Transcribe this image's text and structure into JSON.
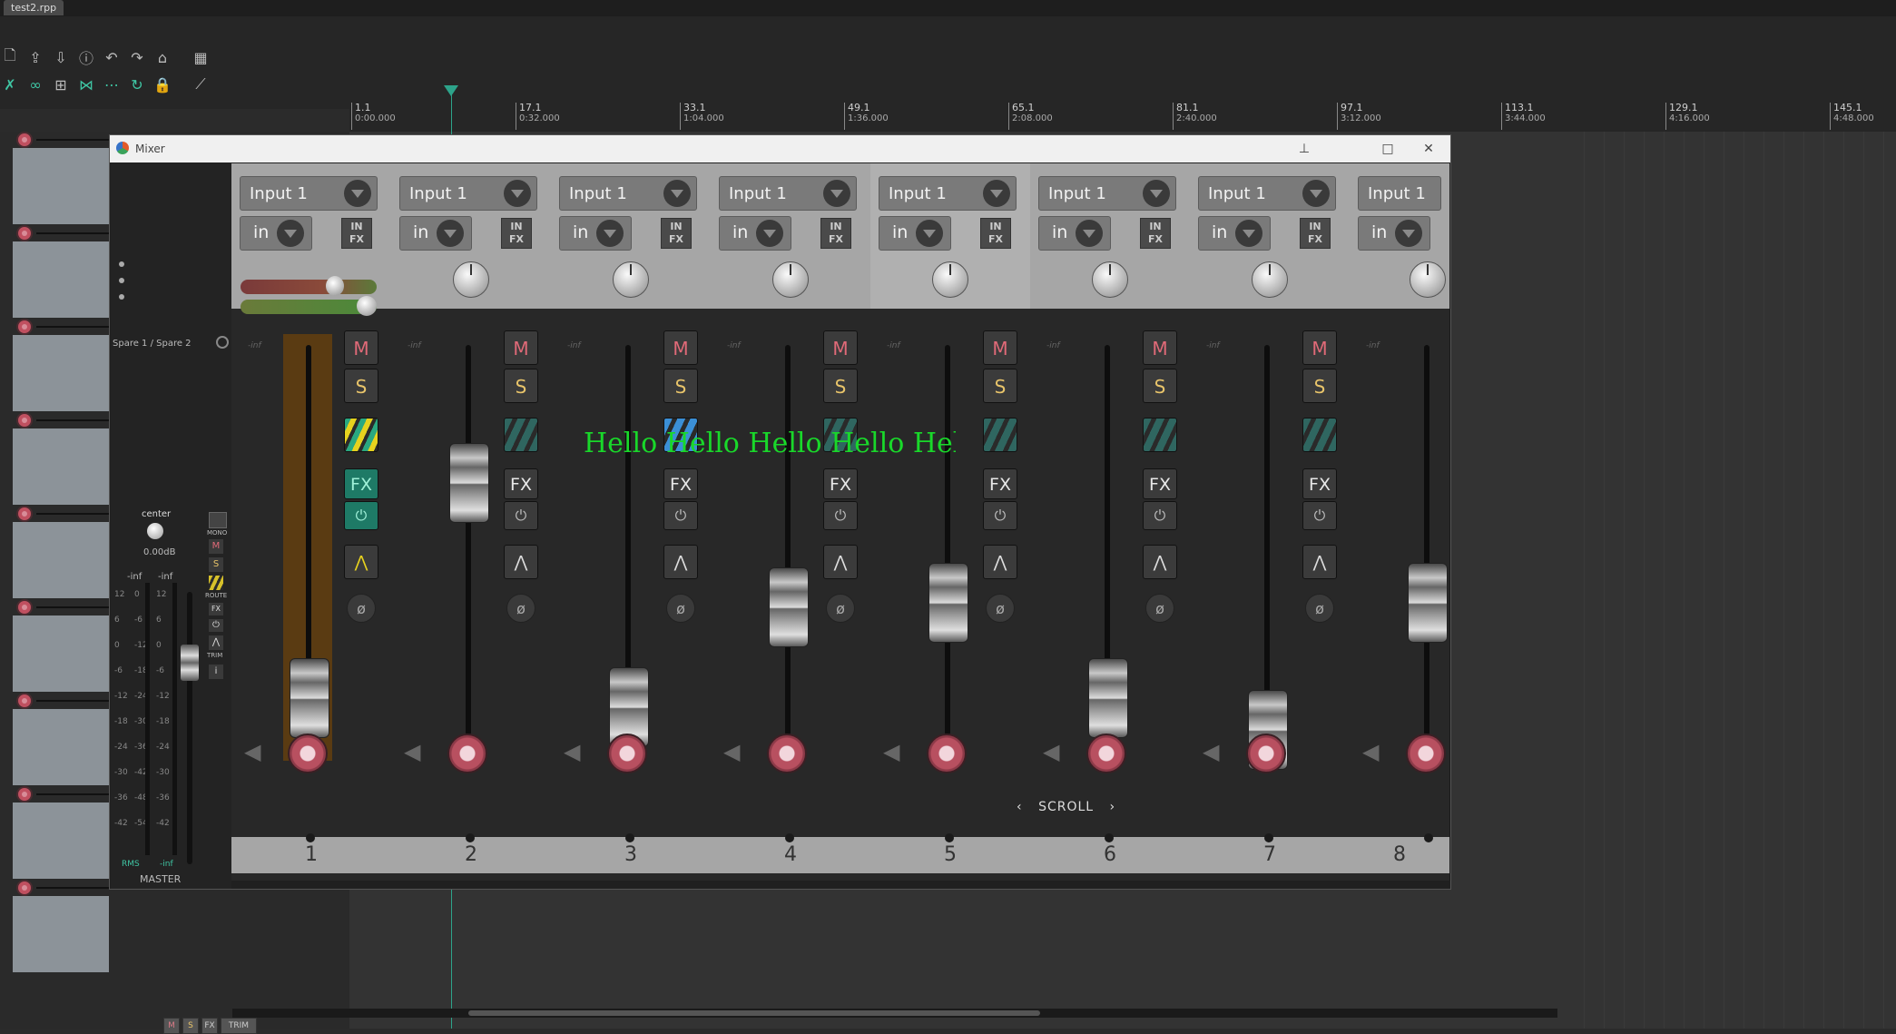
{
  "window": {
    "tab_title": "test2.rpp"
  },
  "ruler": {
    "marks": [
      {
        "bar": "1.1",
        "time": "0:00.000"
      },
      {
        "bar": "17.1",
        "time": "0:32.000"
      },
      {
        "bar": "33.1",
        "time": "1:04.000"
      },
      {
        "bar": "49.1",
        "time": "1:36.000"
      },
      {
        "bar": "65.1",
        "time": "2:08.000"
      },
      {
        "bar": "81.1",
        "time": "2:40.000"
      },
      {
        "bar": "97.1",
        "time": "3:12.000"
      },
      {
        "bar": "113.1",
        "time": "3:44.000"
      },
      {
        "bar": "129.1",
        "time": "4:16.000"
      },
      {
        "bar": "145.1",
        "time": "4:48.000"
      }
    ]
  },
  "tcp": {
    "mini": {
      "m": "M",
      "s": "S",
      "fx": "FX",
      "trim": "TRIM"
    }
  },
  "mixer": {
    "title": "Mixer",
    "master": {
      "label": "MASTER",
      "pan": "center",
      "volume": "0.00dB",
      "meter_left": "-inf",
      "meter_right": "-inf",
      "rms_label": "RMS",
      "rms_value": "-inf",
      "sidechain": "Spare 1 / Spare 2",
      "mono": "MONO",
      "m": "M",
      "s": "S",
      "route": "ROUTE",
      "fx": "FX",
      "trim": "TRIM",
      "info": "i",
      "scale_left": [
        "12",
        "6",
        "0",
        "-6",
        "-12",
        "-18",
        "-24",
        "-30",
        "-36",
        "-42"
      ],
      "scale_mid": [
        "0",
        "-6",
        "-12",
        "-18",
        "-24",
        "-30",
        "-36",
        "-42",
        "-48",
        "-54"
      ],
      "scale_right": [
        "12",
        "6",
        "0",
        "-6",
        "-12",
        "-18",
        "-24",
        "-30",
        "-36",
        "-42"
      ]
    },
    "channel_common": {
      "input": "Input 1",
      "in_mode": "in",
      "infx": "IN FX",
      "m": "M",
      "s": "S",
      "fx": "FX",
      "inf": "-inf"
    },
    "channels": [
      {
        "number": "1"
      },
      {
        "number": "2"
      },
      {
        "number": "3"
      },
      {
        "number": "4"
      },
      {
        "number": "5"
      },
      {
        "number": "6"
      },
      {
        "number": "7"
      },
      {
        "number": "8"
      }
    ],
    "overlay_text": "Hello Hello Hello Hello Hello Hello",
    "scroll_label": "SCROLL"
  }
}
